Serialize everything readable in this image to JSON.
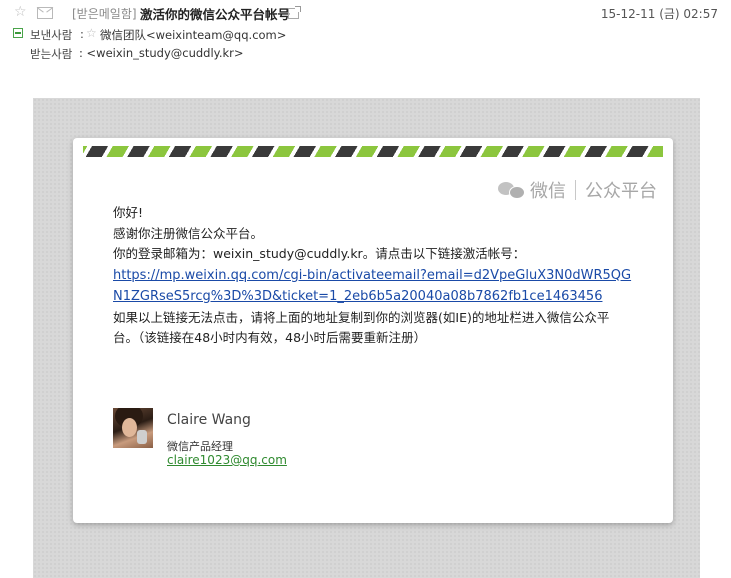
{
  "header": {
    "folder_label": "[받은메일함]",
    "subject": "激活你的微信公众平台帐号",
    "date": "15-12-11 (금) 02:57",
    "from_label": "보낸사람",
    "from_colon": ":",
    "from_value": "微信团队<weixinteam@qq.com>",
    "to_label": "받는사람",
    "to_value": ": <weixin_study@cuddly.kr>"
  },
  "email": {
    "brand_name": "微信",
    "brand_sub": "公众平台",
    "greeting": "你好!",
    "thanks": "感谢你注册微信公众平台。",
    "login_line": "你的登录邮箱为：weixin_study@cuddly.kr。请点击以下链接激活帐号：",
    "activation_link": "https://mp.weixin.qq.com/cgi-bin/activateemail?email=d2VpeGluX3N0dWR5QGN1ZGRseS5rcg%3D%3D&ticket=1_2eb6b5a20040a08b7862fb1ce1463456",
    "fallback_line": "如果以上链接无法点击，请将上面的地址复制到你的浏览器(如IE)的地址栏进入微信公众平台。（该链接在48小时内有效，48小时后需要重新注册）"
  },
  "signature": {
    "name": "Claire Wang",
    "title": "微信产品经理",
    "email": "claire1023@qq.com"
  },
  "colors": {
    "stripe_green": "#8cc63e",
    "stripe_dark": "#3a3a3a",
    "link_blue": "#1a4aa7",
    "sig_green": "#2f8a2f"
  }
}
